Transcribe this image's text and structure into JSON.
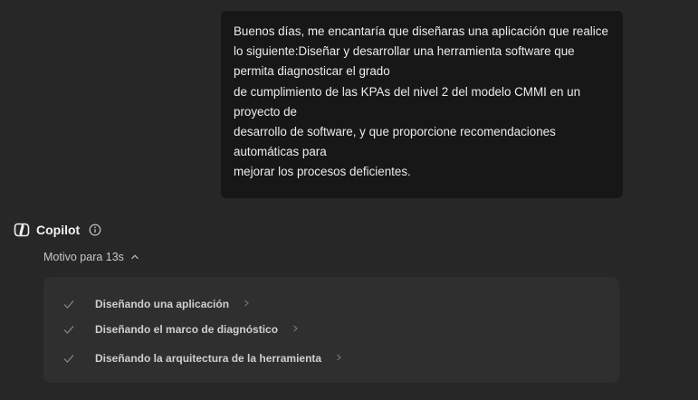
{
  "user_message": {
    "lines": [
      "Buenos días, me encantaría que diseñaras una aplicación que realice",
      "lo siguiente:Diseñar y desarrollar una herramienta software que",
      "permita diagnosticar el grado",
      "de cumplimiento de las KPAs del nivel 2 del modelo CMMI en un",
      "proyecto de",
      "desarrollo de software, y que proporcione recomendaciones",
      "automáticas para",
      "mejorar los procesos deficientes."
    ]
  },
  "assistant": {
    "name": "Copilot",
    "logo_icon": "copilot-logo-icon",
    "info_icon": "info-icon"
  },
  "reasoning": {
    "label": "Motivo para 13s",
    "expanded": true,
    "steps": [
      {
        "label": "Diseñando una aplicación",
        "status": "done"
      },
      {
        "label": "Diseñando el marco de diagnóstico",
        "status": "done"
      },
      {
        "label": "Diseñando la arquitectura de la herramienta",
        "status": "done"
      }
    ]
  },
  "colors": {
    "background": "#272727",
    "user_bubble": "#171717",
    "steps_panel": "#2f2f2f",
    "text": "#ececec",
    "muted_text": "#c7c7c7",
    "check": "#8a8a8a"
  }
}
